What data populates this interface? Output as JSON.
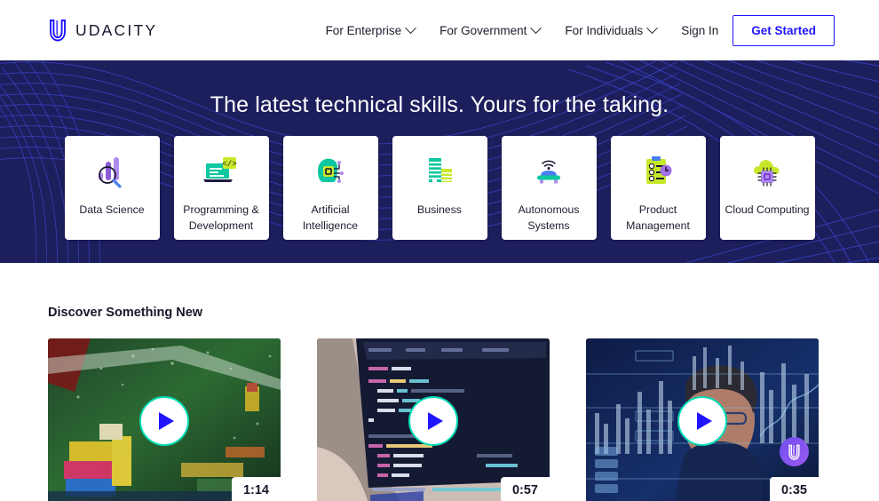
{
  "header": {
    "brand": {
      "wordmark": "UDACITY",
      "logo_icon": "udacity-u-logo-icon"
    },
    "nav": [
      {
        "label": "For Enterprise",
        "icon": "chevron-down-icon"
      },
      {
        "label": "For Government",
        "icon": "chevron-down-icon"
      },
      {
        "label": "For Individuals",
        "icon": "chevron-down-icon"
      }
    ],
    "sign_in": "Sign In",
    "get_started": "Get Started",
    "accent_color": "#2015ff"
  },
  "hero": {
    "title": "The latest technical skills. Yours for the taking.",
    "background_color": "#1d1e5c",
    "categories": [
      {
        "label": "Data Science",
        "icon": "bar-chart-magnifier-icon"
      },
      {
        "label": "Programming & Development",
        "icon": "laptop-code-icon"
      },
      {
        "label": "Artificial Intelligence",
        "icon": "brain-chip-icon"
      },
      {
        "label": "Business",
        "icon": "office-buildings-icon"
      },
      {
        "label": "Autonomous Systems",
        "icon": "self-driving-car-icon"
      },
      {
        "label": "Product Management",
        "icon": "clipboard-clock-icon"
      },
      {
        "label": "Cloud Computing",
        "icon": "cloud-chip-icon"
      }
    ]
  },
  "discover": {
    "title": "Discover Something New",
    "videos": [
      {
        "duration": "1:14",
        "thumbnail": "point-cloud-colorful-scene",
        "play_icon": "play-icon",
        "has_badge": false
      },
      {
        "duration": "0:57",
        "thumbnail": "laptop-code-editor",
        "play_icon": "play-icon",
        "has_badge": false
      },
      {
        "duration": "0:35",
        "thumbnail": "person-with-data-charts",
        "play_icon": "play-icon",
        "has_badge": true,
        "badge_icon": "udacity-u-badge-icon"
      }
    ]
  }
}
